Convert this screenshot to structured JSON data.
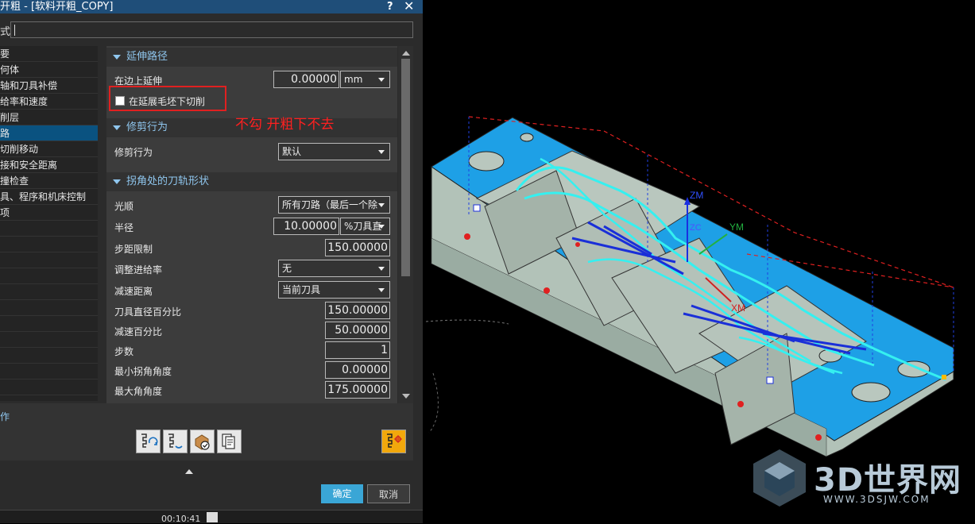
{
  "dialog": {
    "title": "开粗 - [软料开粗_COPY]",
    "help_icon": "?",
    "close_icon": "✕",
    "type_label": "式"
  },
  "tree": {
    "items": [
      {
        "label": "要",
        "selected": false
      },
      {
        "label": "何体",
        "selected": false
      },
      {
        "label": "轴和刀具补偿",
        "selected": false
      },
      {
        "label": "给率和速度",
        "selected": false
      },
      {
        "label": "削层",
        "selected": false
      },
      {
        "label": "路",
        "selected": true
      },
      {
        "label": "切削移动",
        "selected": false
      },
      {
        "label": "接和安全距离",
        "selected": false
      },
      {
        "label": "撞检查",
        "selected": false
      },
      {
        "label": "具、程序和机床控制",
        "selected": false
      },
      {
        "label": "项",
        "selected": false
      },
      {
        "label": "",
        "selected": false
      },
      {
        "label": "",
        "selected": false
      },
      {
        "label": "",
        "selected": false
      },
      {
        "label": "",
        "selected": false
      },
      {
        "label": "",
        "selected": false
      },
      {
        "label": "",
        "selected": false
      },
      {
        "label": "",
        "selected": false
      },
      {
        "label": "",
        "selected": false
      },
      {
        "label": "",
        "selected": false
      },
      {
        "label": "",
        "selected": false
      },
      {
        "label": "",
        "selected": false
      }
    ]
  },
  "extend": {
    "header": "延伸路径",
    "edge_label": "在边上延伸",
    "edge_value": "0.00000",
    "edge_unit": "mm",
    "checkbox_label": "在延展毛坯下切削",
    "checkbox_checked": false
  },
  "annotation": "不勾 开粗下不去",
  "trim": {
    "header": "修剪行为",
    "label": "修剪行为",
    "value": "默认"
  },
  "corner": {
    "header": "拐角处的刀轨形状",
    "smooth_label": "光顺",
    "smooth_value": "所有刀路（最后一个除",
    "radius_label": "半径",
    "radius_value": "10.00000",
    "radius_unit": "%刀具直",
    "step_limit_label": "步距限制",
    "step_limit_value": "150.00000",
    "adjust_feed_label": "调整进给率",
    "adjust_feed_value": "无",
    "slowdown_dist_label": "减速距离",
    "slowdown_dist_value": "当前刀具",
    "tool_dia_pct_label": "刀具直径百分比",
    "tool_dia_pct_value": "150.00000",
    "slowdown_pct_label": "减速百分比",
    "slowdown_pct_value": "50.00000",
    "steps_label": "步数",
    "steps_value": "1",
    "min_corner_label": "最小拐角角度",
    "min_corner_value": "0.00000",
    "max_corner_label": "最大角角度",
    "max_corner_value": "175.00000"
  },
  "operations": {
    "label": "作"
  },
  "buttons": {
    "ok": "确定",
    "cancel": "取消"
  },
  "status": {
    "time": "00:10:41"
  },
  "viewport": {
    "axis_zm": "ZM",
    "axis_ym": "YM",
    "axis_xm": "XM",
    "axis_zc": "ZC"
  },
  "watermark": {
    "title": "3D世界网",
    "url": "WWW.3DSJW.COM"
  },
  "colors": {
    "accent": "#1f4e79",
    "selected": "#0a5280",
    "header_text": "#8fc6ee",
    "ok_button": "#3aa6d6",
    "part_top": "#1ea0e6",
    "part_side": "#aab9b0",
    "toolpath": "#35f0f0",
    "annotation": "#ff2020"
  }
}
